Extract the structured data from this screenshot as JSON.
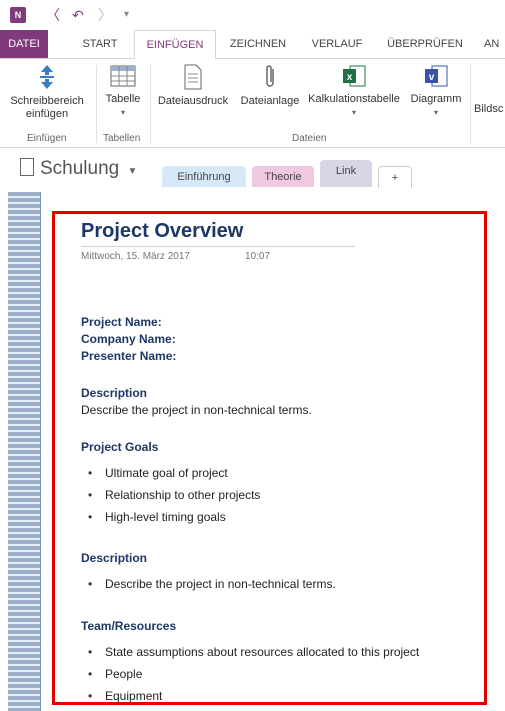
{
  "qat": {
    "logo": "N",
    "icons": [
      "onenote-logo-icon",
      "back-icon",
      "undo-icon",
      "forward-icon",
      "customize-icon"
    ]
  },
  "tabs": [
    "DATEI",
    "START",
    "EINFÜGEN",
    "ZEICHNEN",
    "VERLAUF",
    "ÜBERPRÜFEN",
    "AN"
  ],
  "ribbon": {
    "insert_space_line1": "Schreibbereich",
    "insert_space_line2": "einfügen",
    "table": "Tabelle",
    "file_printout": "Dateiausdruck",
    "file_attachment": "Dateianlage",
    "spreadsheet": "Kalkulationstabelle",
    "diagram": "Diagramm",
    "picture": "Bildsc",
    "group_insert": "Einfügen",
    "group_tables": "Tabellen",
    "group_files": "Dateien"
  },
  "notebook": {
    "name": "Schulung",
    "sections": [
      {
        "label": "Einführung",
        "color": "#d6e7f7"
      },
      {
        "label": "Theorie",
        "color": "#f0c8e0"
      },
      {
        "label": "Link",
        "color": "#d6d6e6"
      },
      {
        "label": "+",
        "color": "#ffffff"
      }
    ]
  },
  "page": {
    "title": "Project Overview",
    "date": "Mittwoch, 15. März 2017",
    "time": "10:07",
    "project_name": "Project Name:",
    "company_name": "Company Name:",
    "presenter_name": "Presenter Name:",
    "desc_heading": "Description",
    "desc_text": "Describe the project in non-technical terms.",
    "goals_heading": "Project Goals",
    "goals": [
      "Ultimate goal of project",
      "Relationship to other projects",
      "High-level timing goals"
    ],
    "desc2_heading": "Description",
    "desc2_items": [
      "Describe the project in non-technical terms."
    ],
    "team_heading": "Team/Resources",
    "team_items": [
      "State assumptions about resources allocated to this project",
      "People",
      "Equipment"
    ]
  },
  "colors": {
    "accent": "#80397b",
    "heading": "#1e3766",
    "highlight_frame": "#e00000"
  }
}
